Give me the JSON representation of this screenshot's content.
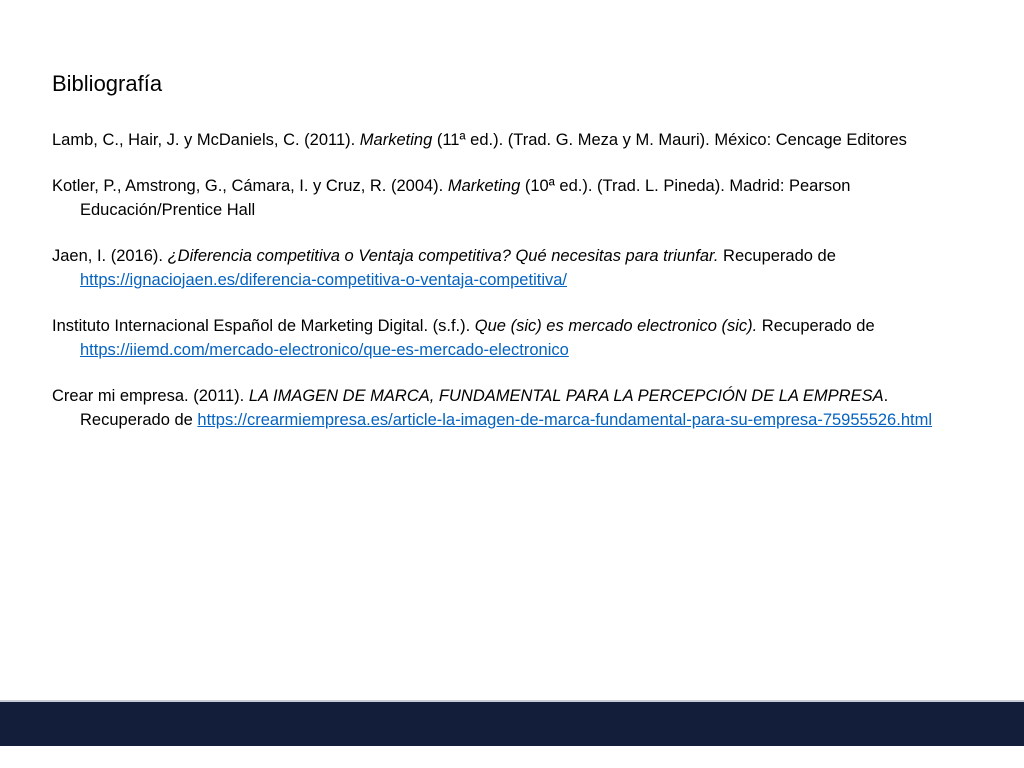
{
  "title": "Bibliografía",
  "references": [
    {
      "authors": "Lamb, C., Hair, J. y McDaniels, C. (2011). ",
      "work": "Marketing",
      "details": " (11ª ed.). (Trad. G. Meza y M. Mauri). México: Cencage Editores"
    },
    {
      "authors": "Kotler, P., Amstrong, G., Cámara, I. y Cruz, R. (2004). ",
      "work": "Marketing",
      "details": " (10ª ed.). (Trad. L. Pineda). Madrid: Pearson Educación/Prentice Hall"
    },
    {
      "authors": "Jaen, I. (2016). ",
      "work": "¿Diferencia competitiva o Ventaja competitiva? Qué necesitas para triunfar.",
      "details": " Recuperado de ",
      "url": "https://ignaciojaen.es/diferencia-competitiva-o-ventaja-competitiva/"
    },
    {
      "authors": "Instituto Internacional Español de Marketing Digital. (s.f.). ",
      "work": "Que (sic) es mercado electronico (sic).",
      "details": " Recuperado de ",
      "url": "https://iiemd.com/mercado-electronico/que-es-mercado-electronico"
    },
    {
      "authors": "Crear mi empresa. (2011). ",
      "work": "LA IMAGEN DE MARCA, FUNDAMENTAL PARA LA PERCEPCIÓN DE LA EMPRESA",
      "details": ". Recuperado de ",
      "url": "https://crearmiempresa.es/article-la-imagen-de-marca-fundamental-para-su-empresa-75955526.html"
    }
  ],
  "colors": {
    "link": "#0563c1",
    "footer_bar": "#131e3a"
  }
}
